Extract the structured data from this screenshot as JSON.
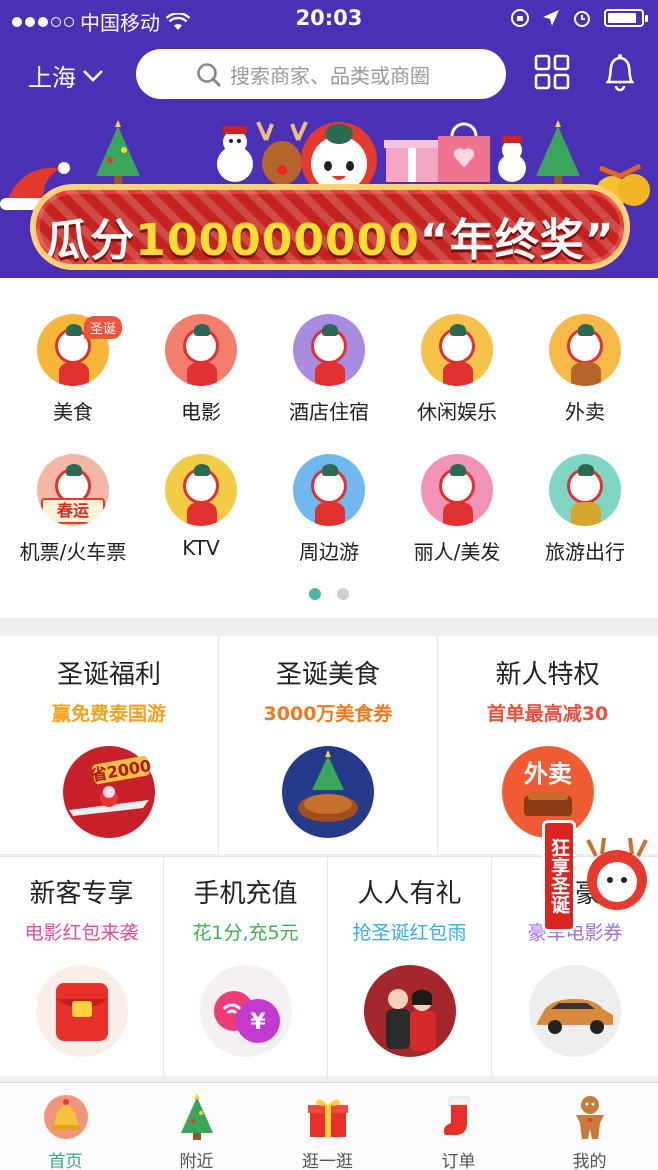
{
  "status_bar": {
    "carrier": "中国移动",
    "time": "20:03"
  },
  "header": {
    "city": "上海",
    "search_placeholder": "搜索商家、品类或商圈"
  },
  "banner": {
    "text_prefix": "瓜分",
    "text_number": "100000000",
    "text_suffix": "“年终奖”"
  },
  "categories": [
    {
      "label": "美食",
      "tag": "圣诞",
      "bg": "#f6b63a"
    },
    {
      "label": "电影",
      "bg": "#f37e6d"
    },
    {
      "label": "酒店住宿",
      "bg": "#a98be0"
    },
    {
      "label": "休闲娱乐",
      "bg": "#f7c24a"
    },
    {
      "label": "外卖",
      "bg": "#f6b948"
    },
    {
      "label": "机票/火车票",
      "badge": "春运",
      "bg": "#f3b7a3"
    },
    {
      "label": "KTV",
      "bg": "#f3cc45"
    },
    {
      "label": "周边游",
      "bg": "#70b8ef"
    },
    {
      "label": "丽人/美发",
      "bg": "#f192b7"
    },
    {
      "label": "旅游出行",
      "bg": "#7fd6c5"
    }
  ],
  "pager": {
    "pages": 2,
    "active": 1
  },
  "promos_row1": [
    {
      "title": "圣诞福利",
      "subtitle": "赢免费泰国游",
      "color": "#f2a21c",
      "art": "省2000"
    },
    {
      "title": "圣诞美食",
      "subtitle": "3000万美食券",
      "color": "#f07a1c"
    },
    {
      "title": "新人特权",
      "subtitle": "首单最高减30",
      "color": "#ef4e3f",
      "art": "外卖"
    }
  ],
  "promos_row2": [
    {
      "title": "新客专享",
      "subtitle": "电影红包来袭",
      "color": "#e94c9b"
    },
    {
      "title": "手机充值",
      "subtitle": "花1分,充5元",
      "color": "#3bb24e",
      "art": "¥"
    },
    {
      "title": "人人有礼",
      "subtitle": "抢圣诞红包雨",
      "color": "#33aee8"
    },
    {
      "title": "帝豪",
      "subtitle": "豪车电影券",
      "color": "#9c6fe0"
    }
  ],
  "floating_badge": {
    "text": "狂享圣诞"
  },
  "tabs": [
    {
      "label": "首页",
      "icon": "bell-ornament-icon",
      "active": true
    },
    {
      "label": "附近",
      "icon": "christmas-tree-icon"
    },
    {
      "label": "逛一逛",
      "icon": "gift-box-icon"
    },
    {
      "label": "订单",
      "icon": "stocking-icon"
    },
    {
      "label": "我的",
      "icon": "gingerbread-man-icon"
    }
  ]
}
